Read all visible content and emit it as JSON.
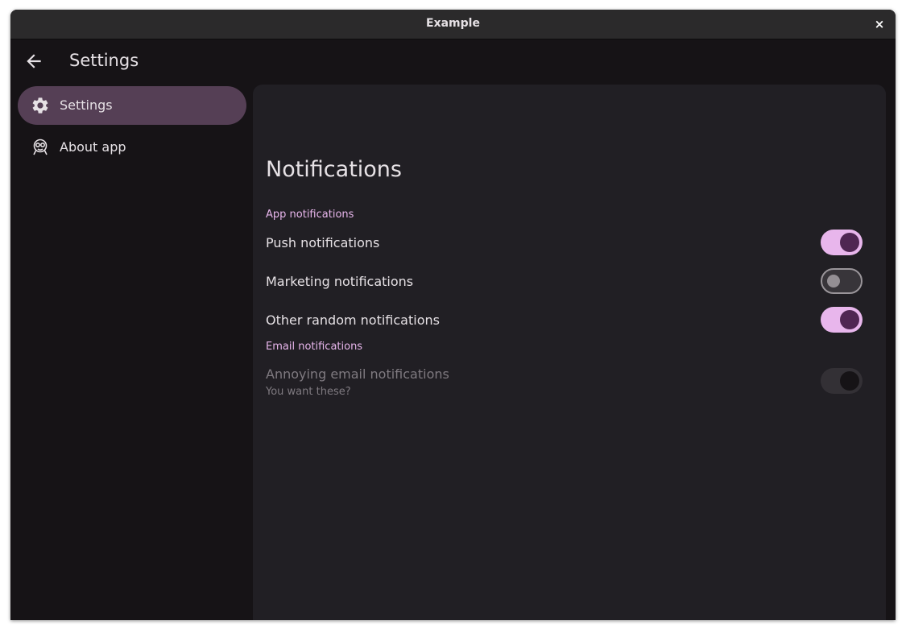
{
  "window": {
    "title": "Example",
    "close_label": "×"
  },
  "header": {
    "title": "Settings"
  },
  "sidebar": {
    "items": [
      {
        "label": "Settings",
        "icon": "gear-icon",
        "active": true
      },
      {
        "label": "About app",
        "icon": "app-logo-icon",
        "active": false
      }
    ]
  },
  "main": {
    "title": "Notifications",
    "sections": [
      {
        "header": "App notifications",
        "settings": [
          {
            "label": "Push notifications",
            "state": "on"
          },
          {
            "label": "Marketing notifications",
            "state": "off"
          },
          {
            "label": "Other random notifications",
            "state": "on"
          }
        ]
      },
      {
        "header": "Email notifications",
        "settings": [
          {
            "label": "Annoying email notifications",
            "subtitle": "You want these?",
            "state": "on",
            "disabled": true
          }
        ]
      }
    ]
  },
  "colors": {
    "window_bg": "#161316",
    "titlebar_bg": "#2b2a2b",
    "content_bg": "#211f24",
    "active_nav_bg": "#553f55",
    "accent": "#e8b6ec",
    "switch_thumb_on": "#4f2652",
    "text_primary": "#e6e1e5",
    "text_disabled": "#7f7a80"
  }
}
